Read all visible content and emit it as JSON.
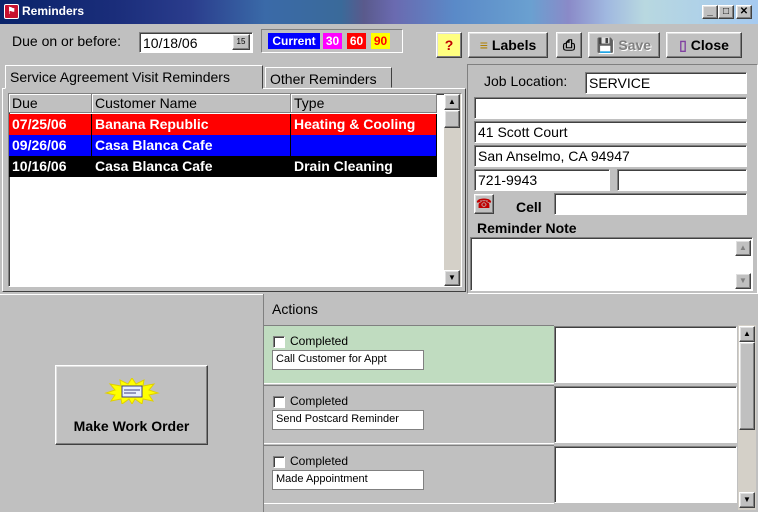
{
  "window": {
    "title": "Reminders",
    "icon": "app-flag-icon"
  },
  "toolbar": {
    "due_label": "Due on or before:",
    "due_date": "10/18/06",
    "calendar_button": "15",
    "aging": [
      {
        "label": "Current",
        "bg": "#0000ff",
        "fg": "#ffffff"
      },
      {
        "label": "30",
        "bg": "#ff00ff",
        "fg": "#ffffff"
      },
      {
        "label": "60",
        "bg": "#ff0000",
        "fg": "#ffffff"
      },
      {
        "label": "90",
        "bg": "#ffff00",
        "fg": "#ff0000"
      }
    ],
    "help_label": "?",
    "labels_label": "Labels",
    "print_icon": "printer-icon",
    "save_label": "Save",
    "close_label": "Close"
  },
  "tabs": [
    {
      "label": "Service Agreement Visit Reminders",
      "active": true
    },
    {
      "label": "Other Reminders",
      "active": false
    }
  ],
  "grid": {
    "columns": [
      "Due",
      "Customer Name",
      "Type"
    ],
    "rows": [
      {
        "due": "07/25/06",
        "customer": "Banana Republic",
        "type": "Heating & Cooling",
        "bg": "#ff0000"
      },
      {
        "due": "09/26/06",
        "customer": "Casa Blanca Cafe",
        "type": "",
        "bg": "#0000ff"
      },
      {
        "due": "10/16/06",
        "customer": "Casa Blanca Cafe",
        "type": "Drain Cleaning",
        "bg": "#000000"
      }
    ]
  },
  "job": {
    "location_label": "Job Location:",
    "location_value": "SERVICE",
    "line1": "",
    "address": "41 Scott Court",
    "city_state_zip": "San Anselmo, CA 94947",
    "phone": "721-9943",
    "phone2": "",
    "cell_label": "Cell",
    "cell_value": "",
    "note_label": "Reminder Note",
    "note_value": ""
  },
  "make_work_order_label": "Make Work Order",
  "actions": {
    "title": "Actions",
    "completed_label": "Completed",
    "items": [
      {
        "text": "Call Customer for Appt",
        "bg": "#c0dcc0"
      },
      {
        "text": "Send Postcard Reminder",
        "bg": "#c0c0c0"
      },
      {
        "text": "Made Appointment",
        "bg": "#c0c0c0"
      }
    ]
  }
}
